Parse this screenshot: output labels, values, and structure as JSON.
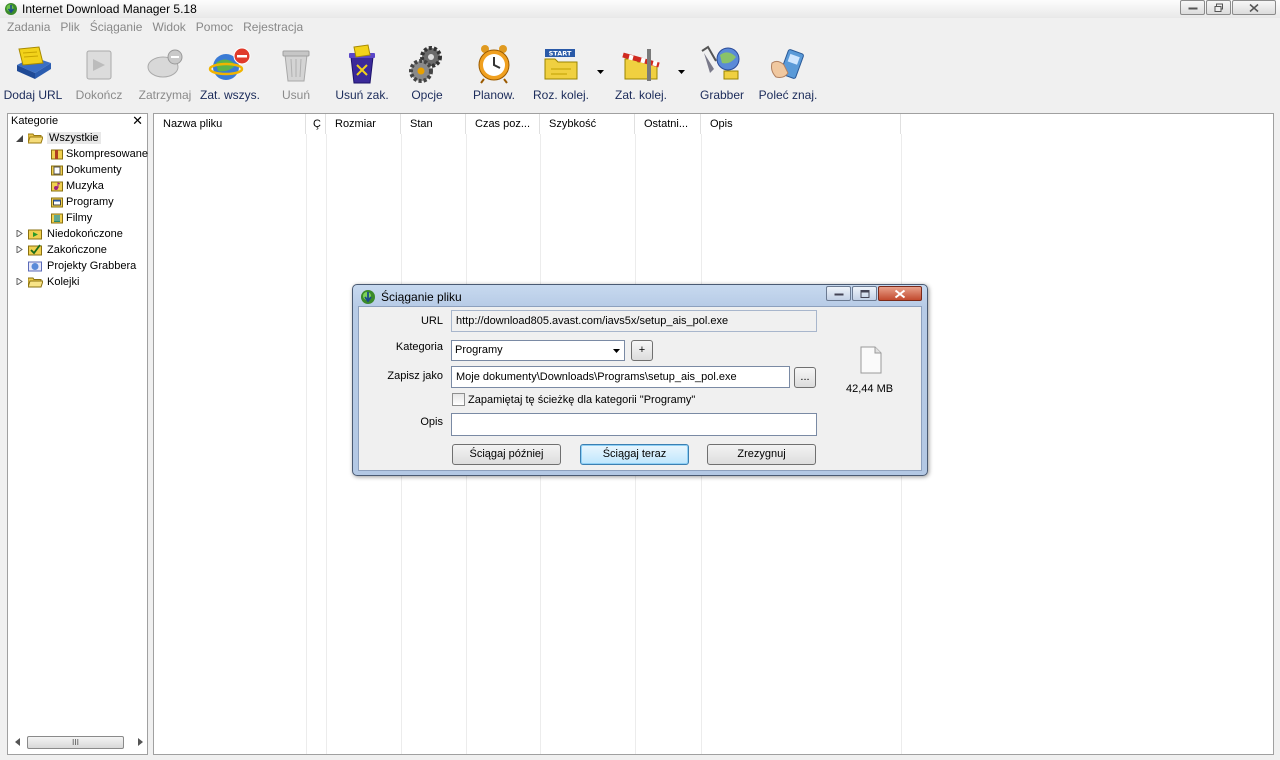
{
  "window": {
    "title": "Internet Download Manager 5.18"
  },
  "menu": [
    "Zadania",
    "Plik",
    "Ściąganie",
    "Widok",
    "Pomoc",
    "Rejestracja"
  ],
  "toolbar": [
    {
      "label": "Dodaj URL",
      "icon": "add-url-icon",
      "enabled": true
    },
    {
      "label": "Dokończ",
      "icon": "resume-icon",
      "enabled": false
    },
    {
      "label": "Zatrzymaj",
      "icon": "stop-icon",
      "enabled": false
    },
    {
      "label": "Zat. wszys.",
      "icon": "stop-all-icon",
      "enabled": true
    },
    {
      "label": "Usuń",
      "icon": "delete-icon",
      "enabled": false
    },
    {
      "label": "Usuń zak.",
      "icon": "delete-completed-icon",
      "enabled": true
    },
    {
      "label": "Opcje",
      "icon": "options-gear-icon",
      "enabled": true
    },
    {
      "label": "Planow.",
      "icon": "scheduler-clock-icon",
      "enabled": true
    },
    {
      "label": "Roz. kolej.",
      "icon": "start-queue-icon",
      "enabled": true
    },
    {
      "label": "Zat. kolej.",
      "icon": "stop-queue-icon",
      "enabled": true
    },
    {
      "label": "Grabber",
      "icon": "grabber-icon",
      "enabled": true
    },
    {
      "label": "Poleć znaj.",
      "icon": "tell-friend-icon",
      "enabled": true
    }
  ],
  "categories": {
    "header": "Kategorie",
    "close": "✕",
    "items": [
      {
        "label": "Wszystkie",
        "level": 0,
        "expanded": true,
        "selected": true
      },
      {
        "label": "Skompresowane",
        "level": 1
      },
      {
        "label": "Dokumenty",
        "level": 1
      },
      {
        "label": "Muzyka",
        "level": 1
      },
      {
        "label": "Programy",
        "level": 1
      },
      {
        "label": "Filmy",
        "level": 1
      },
      {
        "label": "Niedokończone",
        "level": 0,
        "expandable": true
      },
      {
        "label": "Zakończone",
        "level": 0,
        "expandable": true
      },
      {
        "label": "Projekty Grabbera",
        "level": 0
      },
      {
        "label": "Kolejki",
        "level": 0,
        "expandable": true
      }
    ],
    "scroll_thumb": "III"
  },
  "filelist": {
    "columns": [
      "Nazwa pliku",
      "Ç",
      "Rozmiar",
      "Stan",
      "Czas poz...",
      "Szybkość",
      "Ostatni...",
      "Opis"
    ]
  },
  "dialog": {
    "title": "Ściąganie pliku",
    "url_label": "URL",
    "url_value": "http://download805.avast.com/iavs5x/setup_ais_pol.exe",
    "category_label": "Kategoria",
    "category_value": "Programy",
    "add_category": "+",
    "save_label": "Zapisz jako",
    "save_value": "Moje dokumenty\\Downloads\\Programs\\setup_ais_pol.exe",
    "browse": "...",
    "remember_label": "Zapamiętaj tę ścieżkę dla kategorii \"Programy\"",
    "remember_checked": false,
    "desc_label": "Opis",
    "desc_value": "",
    "file_size": "42,44 MB",
    "btn_later": "Ściągaj później",
    "btn_now": "Ściągaj teraz",
    "btn_cancel": "Zrezygnuj"
  }
}
